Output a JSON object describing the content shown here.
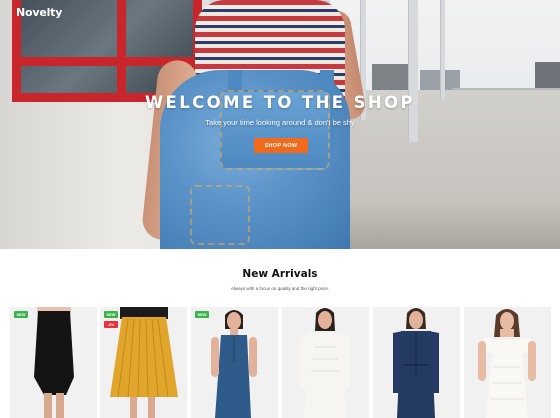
{
  "header": {
    "logo": "Novelty"
  },
  "hero": {
    "title": "WELCOME TO THE SHOP",
    "subtitle": "Take your time looking around & don't be shy",
    "button_label": "SHOP NOW",
    "button_color": "#f26a1b"
  },
  "arrivals": {
    "title": "New Arrivals",
    "subtitle": "Always with a focus on quality and the right price.",
    "products": [
      {
        "badges": [
          "NEW"
        ],
        "item": "black pencil skirt"
      },
      {
        "badges": [
          "NEW",
          "-6%"
        ],
        "item": "mustard pleated skirt"
      },
      {
        "badges": [
          "NEW"
        ],
        "item": "denim sleeveless dress"
      },
      {
        "badges": [],
        "item": "white lace dress"
      },
      {
        "badges": [],
        "item": "navy shirt dress"
      },
      {
        "badges": [],
        "item": "white off-shoulder dress"
      }
    ]
  },
  "colors": {
    "badge_new": "#3bb54a",
    "badge_sale": "#e5313b"
  }
}
